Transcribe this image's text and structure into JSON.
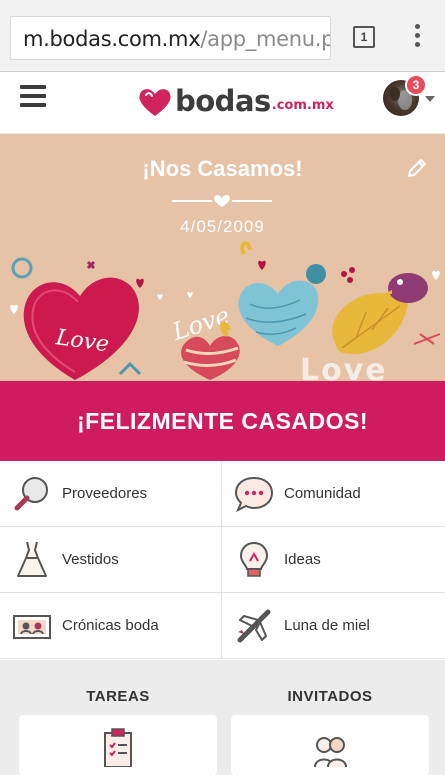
{
  "browser": {
    "url_host": "m.bodas.com.mx",
    "url_path": "/app_menu.ph",
    "tab_count": "1"
  },
  "header": {
    "logo_text": "bodas",
    "logo_domain": ".com.mx",
    "notification_count": "3"
  },
  "banner": {
    "title": "¡Nos Casamos!",
    "date": "4/05/2009",
    "art_words": [
      "Love",
      "Love",
      "Love"
    ]
  },
  "status": {
    "label": "¡FELIZMENTE CASADOS!"
  },
  "menu": {
    "items": [
      {
        "label": "Proveedores",
        "icon": "magnifier-icon"
      },
      {
        "label": "Comunidad",
        "icon": "chat-bubble-icon"
      },
      {
        "label": "Vestidos",
        "icon": "dress-icon"
      },
      {
        "label": "Ideas",
        "icon": "lightbulb-icon"
      },
      {
        "label": "Crónicas boda",
        "icon": "photo-album-icon"
      },
      {
        "label": "Luna de miel",
        "icon": "airplane-icon"
      }
    ]
  },
  "sections": {
    "tasks_title": "TAREAS",
    "guests_title": "INVITADOS"
  },
  "colors": {
    "brand": "#cf1c5e",
    "banner_bg": "#e6c2a6",
    "badge": "#e74c5b"
  }
}
